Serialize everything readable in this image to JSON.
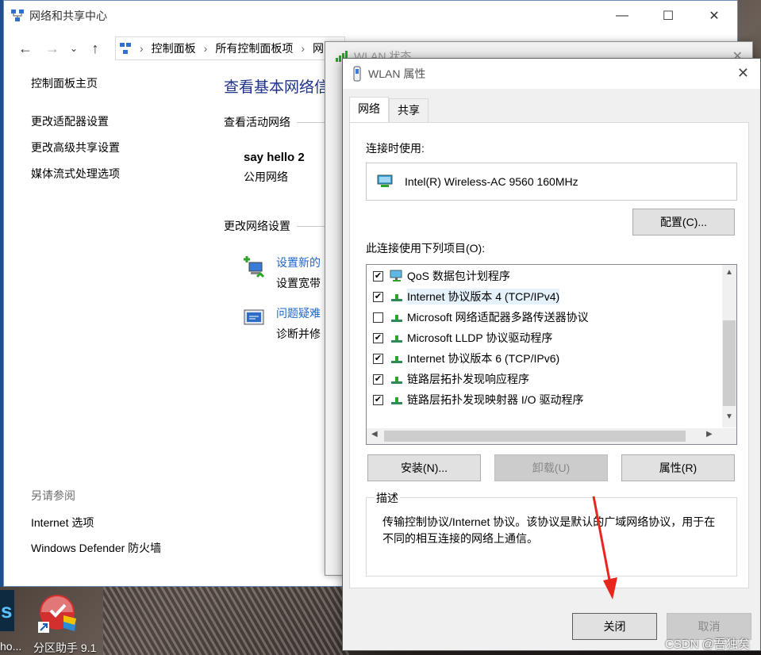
{
  "control_panel": {
    "title": "网络和共享中心",
    "breadcrumb": [
      "控制面板",
      "所有控制面板项",
      "网"
    ],
    "sidebar": {
      "home": "控制面板主页",
      "links": [
        "更改适配器设置",
        "更改高级共享设置",
        "媒体流式处理选项"
      ],
      "see_also_header": "另请参阅",
      "see_also": [
        "Internet 选项",
        "Windows Defender 防火墙"
      ]
    },
    "main": {
      "title": "查看基本网络信",
      "active_networks_header": "查看活动网络",
      "network_name": "say hello 2",
      "network_type": "公用网络",
      "change_settings_header": "更改网络设置",
      "tasks": [
        {
          "link": "设置新的",
          "desc": "设置宽带"
        },
        {
          "link": "问题疑难",
          "desc": "诊断并修"
        }
      ]
    }
  },
  "status_window": {
    "title": "WLAN 状态"
  },
  "dialog": {
    "title": "WLAN 属性",
    "tabs": [
      "网络",
      "共享"
    ],
    "connect_using_label": "连接时使用:",
    "adapter": "Intel(R) Wireless-AC 9560 160MHz",
    "configure_button": "配置(C)...",
    "items_label": "此连接使用下列项目(O):",
    "items": [
      {
        "checked": true,
        "label": "QoS 数据包计划程序",
        "icon": "qos-icon"
      },
      {
        "checked": true,
        "label": "Internet 协议版本 4 (TCP/IPv4)",
        "icon": "protocol-icon",
        "selected": true
      },
      {
        "checked": false,
        "label": "Microsoft 网络适配器多路传送器协议",
        "icon": "protocol-icon"
      },
      {
        "checked": true,
        "label": "Microsoft LLDP 协议驱动程序",
        "icon": "protocol-icon"
      },
      {
        "checked": true,
        "label": "Internet 协议版本 6 (TCP/IPv6)",
        "icon": "protocol-icon"
      },
      {
        "checked": true,
        "label": "链路层拓扑发现响应程序",
        "icon": "protocol-icon"
      },
      {
        "checked": true,
        "label": "链路层拓扑发现映射器 I/O 驱动程序",
        "icon": "protocol-icon"
      }
    ],
    "install_button": "安装(N)...",
    "uninstall_button": "卸载(U)",
    "properties_button": "属性(R)",
    "description_label": "描述",
    "description_text": "传输控制协议/Internet 协议。该协议是默认的广域网络协议，用于在不同的相互连接的网络上通信。",
    "close_button": "关闭",
    "cancel_button": "取消"
  },
  "desktop": {
    "icon_label": "分区助手 9.1",
    "partial_label": "ho..."
  },
  "watermark": "CSDN @吾独矣",
  "colors": {
    "link": "#1e66c8",
    "title_blue": "#1e3287",
    "arrow_red": "#e8261e"
  }
}
